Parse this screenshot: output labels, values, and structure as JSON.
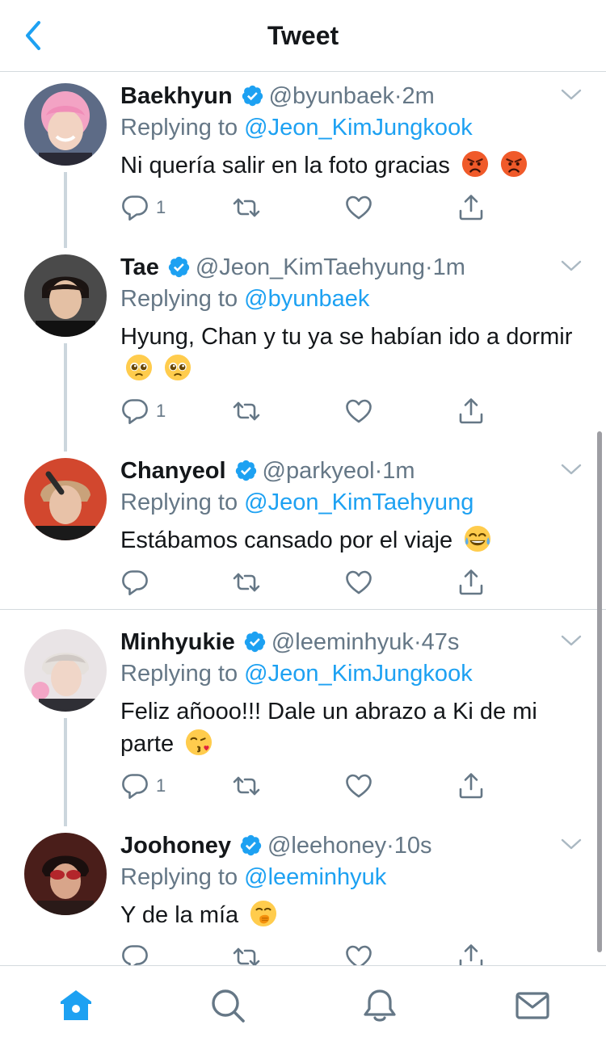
{
  "header": {
    "title": "Tweet"
  },
  "tweets": [
    {
      "name": "Baekhyun",
      "handle": "@byunbaek",
      "separator": "·",
      "time": "2m",
      "replying_prefix": "Replying to",
      "replying_to": "@Jeon_KimJungkook",
      "text": "Ni quería salir en la foto gracias",
      "emojis": [
        "pouting-face",
        "pouting-face"
      ],
      "reply_count": "1"
    },
    {
      "name": "Tae",
      "handle": "@Jeon_KimTaehyung",
      "separator": "·",
      "time": "1m",
      "replying_prefix": "Replying to",
      "replying_to": "@byunbaek",
      "text": "Hyung, Chan y tu ya se habían ido a dormir",
      "emojis": [
        "pleading-face",
        "pleading-face"
      ],
      "reply_count": "1"
    },
    {
      "name": "Chanyeol",
      "handle": "@parkyeol",
      "separator": "·",
      "time": "1m",
      "replying_prefix": "Replying to",
      "replying_to": "@Jeon_KimTaehyung",
      "text": "Estábamos cansado por el viaje",
      "emojis": [
        "tears-of-joy-face"
      ],
      "reply_count": ""
    },
    {
      "name": "Minhyukie",
      "handle": "@leeminhyuk",
      "separator": "·",
      "time": "47s",
      "replying_prefix": "Replying to",
      "replying_to": "@Jeon_KimJungkook",
      "text": "Feliz añooo!!! Dale un abrazo a Ki de mi parte",
      "emojis": [
        "kissing-face"
      ],
      "reply_count": "1"
    },
    {
      "name": "Joohoney",
      "handle": "@leehoney",
      "separator": "·",
      "time": "10s",
      "replying_prefix": "Replying to",
      "replying_to": "@leeminhyuk",
      "text": "Y de la mía",
      "emojis": [
        "hand-over-mouth-face"
      ],
      "reply_count": ""
    }
  ],
  "tabbar": {
    "items": [
      "home-icon",
      "search-icon",
      "notifications-icon",
      "messages-icon"
    ],
    "active": "home-icon"
  },
  "colors": {
    "accent": "#1da1f2",
    "secondary_text": "#657786",
    "primary_text": "#14171a",
    "divider": "#d4dade"
  }
}
